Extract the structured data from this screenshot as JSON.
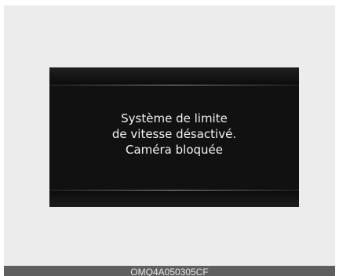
{
  "display": {
    "message_lines": [
      "Système de limite",
      "de vitesse désactivé.",
      "Caméra bloquée"
    ]
  },
  "footer": {
    "code": "OMQ4A050305CF"
  }
}
